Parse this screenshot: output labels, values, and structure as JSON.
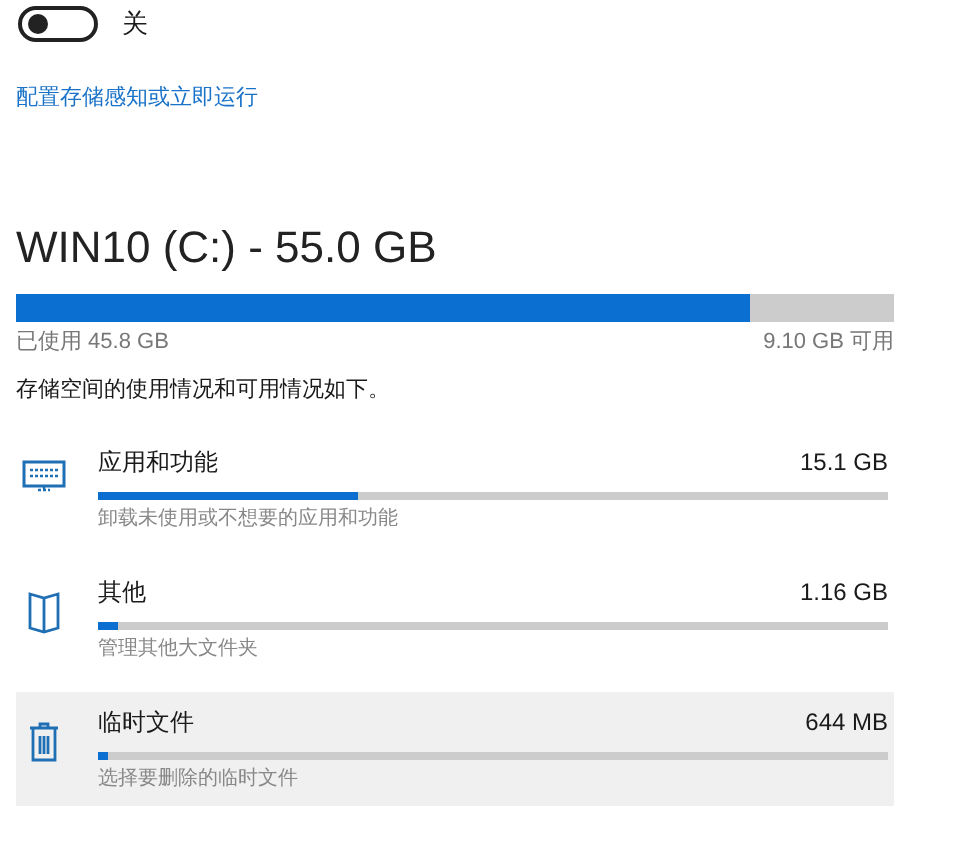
{
  "toggle": {
    "on": false,
    "label": "关"
  },
  "link": "配置存储感知或立即运行",
  "drive": {
    "title": "WIN10 (C:) - 55.0 GB",
    "level": 0.835,
    "used": "已使用 45.8 GB",
    "free": "9.10 GB 可用"
  },
  "description": "存储空间的使用情况和可用情况如下。",
  "categories": [
    {
      "kind": "apps",
      "name": "应用和功能",
      "size": "15.1 GB",
      "level": 0.33,
      "hint": "卸载未使用或不想要的应用和功能",
      "hovered": false
    },
    {
      "kind": "other",
      "name": "其他",
      "size": "1.16 GB",
      "level": 0.025,
      "hint": "管理其他大文件夹",
      "hovered": false
    },
    {
      "kind": "temp",
      "name": "临时文件",
      "size": "644 MB",
      "level": 0.012,
      "hint": "选择要删除的临时文件",
      "hovered": true
    }
  ]
}
